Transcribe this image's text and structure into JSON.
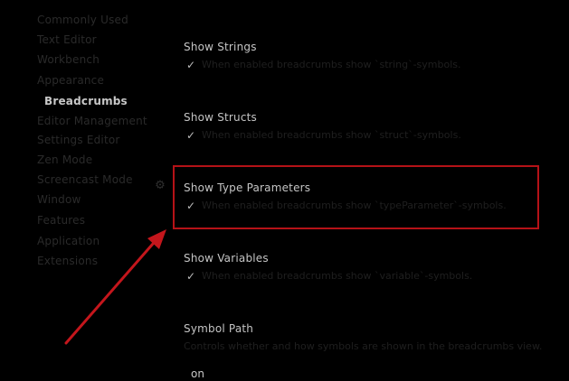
{
  "sidebar": {
    "items": [
      {
        "label": "Commonly Used",
        "active": false
      },
      {
        "label": "Text Editor",
        "active": false
      },
      {
        "label": "Workbench",
        "active": false
      },
      {
        "label": "Appearance",
        "active": false
      },
      {
        "label": "Breadcrumbs",
        "active": true
      },
      {
        "label": "Editor Management",
        "active": false
      },
      {
        "label": "Settings Editor",
        "active": false
      },
      {
        "label": "Zen Mode",
        "active": false
      },
      {
        "label": "Screencast Mode",
        "active": false
      },
      {
        "label": "Window",
        "active": false
      },
      {
        "label": "Features",
        "active": false
      },
      {
        "label": "Application",
        "active": false
      },
      {
        "label": "Extensions",
        "active": false
      }
    ]
  },
  "settings": [
    {
      "title": "Show Strings",
      "checked": true,
      "description": "When enabled breadcrumbs show `string`-symbols."
    },
    {
      "title": "Show Structs",
      "checked": true,
      "description": "When enabled breadcrumbs show `struct`-symbols."
    },
    {
      "title": "Show Type Parameters",
      "checked": true,
      "description": "When enabled breadcrumbs show `typeParameter`-symbols."
    },
    {
      "title": "Show Variables",
      "checked": true,
      "description": "When enabled breadcrumbs show `variable`-symbols."
    }
  ],
  "symbol_path": {
    "title": "Symbol Path",
    "description": "Controls whether and how symbols are shown in the breadcrumbs view.",
    "value": "on"
  },
  "colors": {
    "highlight": "#b51217",
    "arrow": "#c4161c",
    "background": "#000000"
  },
  "icons": {
    "gear": "gear-icon",
    "check": "checkmark-icon"
  }
}
